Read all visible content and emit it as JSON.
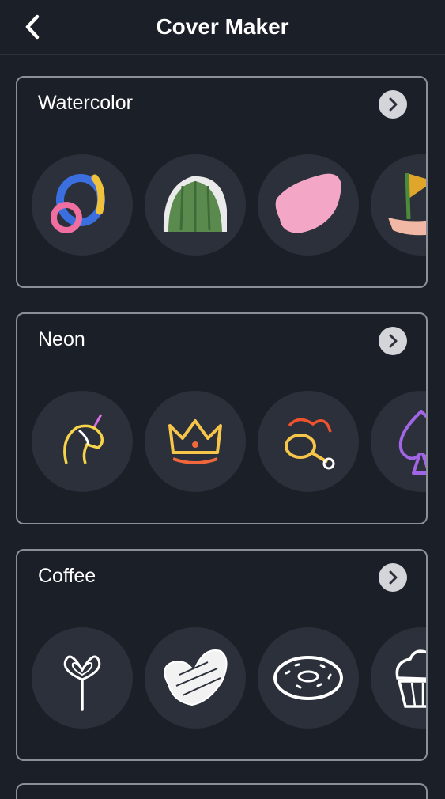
{
  "header": {
    "title": "Cover Maker",
    "back_icon": "chevron-left-icon"
  },
  "sections": [
    {
      "title": "Watercolor",
      "more_icon": "chevron-right-icon",
      "items": [
        {
          "icon": "watercolor-rings-icon"
        },
        {
          "icon": "watercolor-cactus-icon"
        },
        {
          "icon": "watercolor-pink-blob-icon"
        },
        {
          "icon": "watercolor-sailboat-icon"
        }
      ]
    },
    {
      "title": "Neon",
      "more_icon": "chevron-right-icon",
      "items": [
        {
          "icon": "neon-unicorn-icon"
        },
        {
          "icon": "neon-crown-icon"
        },
        {
          "icon": "neon-chicken-leg-icon"
        },
        {
          "icon": "neon-spade-icon"
        }
      ]
    },
    {
      "title": "Coffee",
      "more_icon": "chevron-right-icon",
      "items": [
        {
          "icon": "heart-lollipop-icon"
        },
        {
          "icon": "sketch-heart-icon"
        },
        {
          "icon": "donut-icon"
        },
        {
          "icon": "cupcake-icon"
        }
      ]
    }
  ],
  "colors": {
    "background": "#1b1f28",
    "circle": "#2b303a",
    "card_border": "#8b8f97",
    "button": "#d4d5d8"
  }
}
